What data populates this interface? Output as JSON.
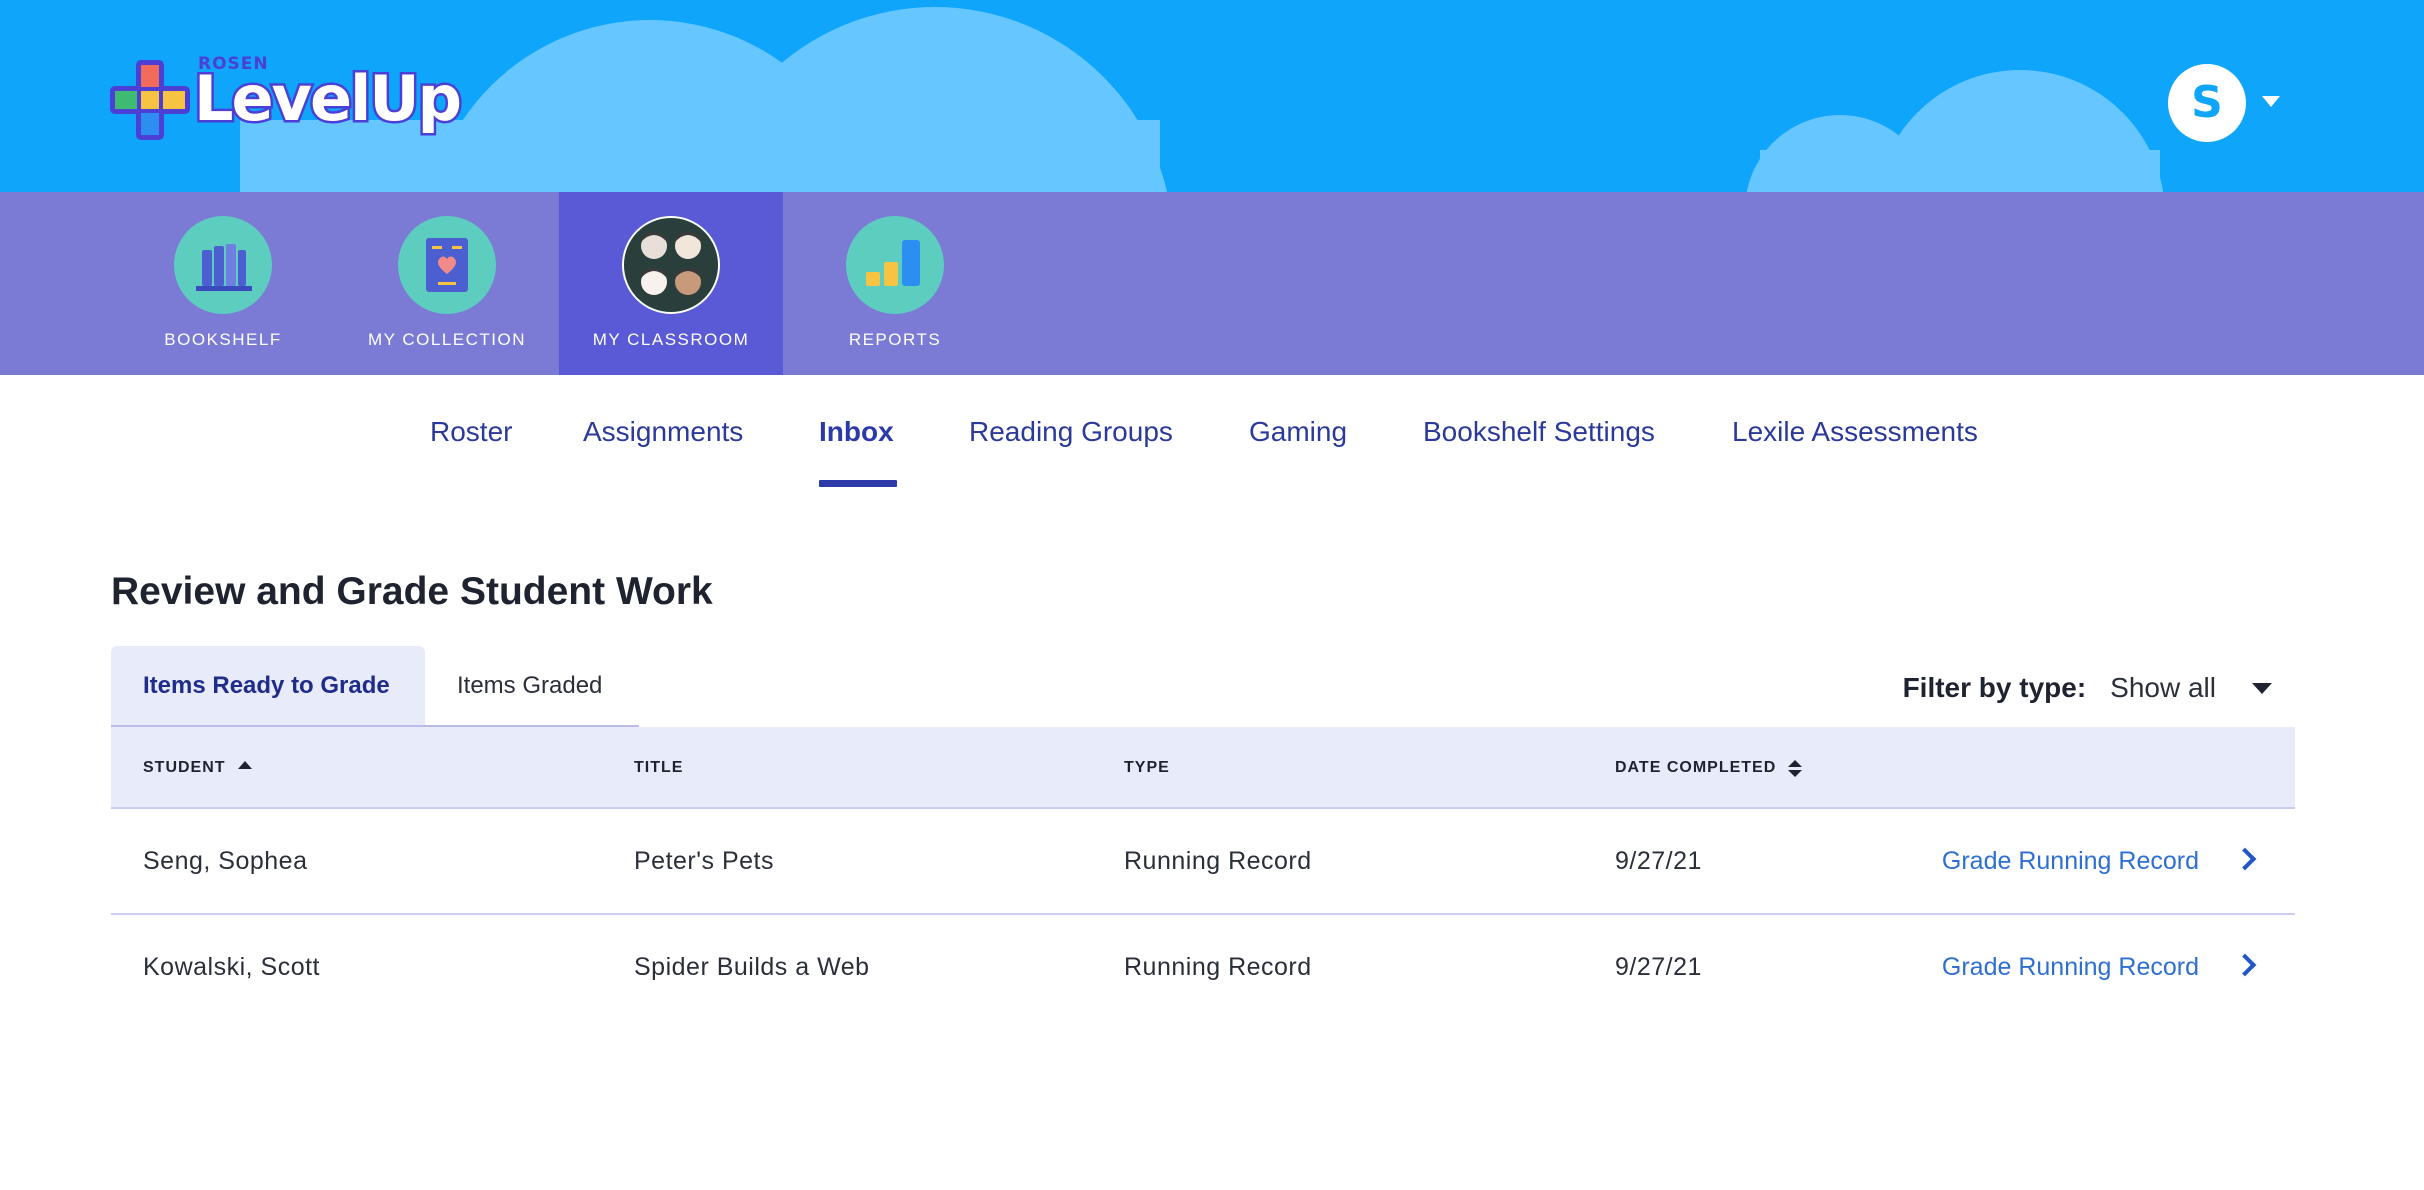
{
  "header": {
    "logo_sub": "ROSEN",
    "logo_main": "LevelUp",
    "avatar_initial": "S",
    "colors": {
      "sky": "#0ea5fa",
      "cloud": "#66c6ff",
      "logo_outline": "#4b3fd6"
    }
  },
  "main_nav": {
    "items": [
      {
        "label": "BOOKSHELF",
        "icon": "bookshelf-icon",
        "active": false
      },
      {
        "label": "MY COLLECTION",
        "icon": "book-heart-icon",
        "active": false
      },
      {
        "label": "MY CLASSROOM",
        "icon": "students-icon",
        "active": true
      },
      {
        "label": "REPORTS",
        "icon": "bar-chart-icon",
        "active": false
      }
    ],
    "colors": {
      "bar": "#7b7bd6",
      "active": "#5a59d6",
      "icon_bg": "#5ccdbf"
    }
  },
  "sub_nav": {
    "tabs": [
      "Roster",
      "Assignments",
      "Inbox",
      "Reading Groups",
      "Gaming",
      "Bookshelf Settings",
      "Lexile Assessments"
    ],
    "active": "Inbox"
  },
  "content": {
    "title": "Review and Grade Student Work",
    "tabs": {
      "ready": "Items Ready to Grade",
      "graded": "Items Graded",
      "active": "Items Ready to Grade"
    },
    "filter": {
      "label": "Filter by type:",
      "value": "Show all"
    },
    "table": {
      "columns": [
        "STUDENT",
        "TITLE",
        "TYPE",
        "DATE COMPLETED"
      ],
      "rows": [
        {
          "student": "Seng, Sophea",
          "title": "Peter's Pets",
          "type": "Running Record",
          "date": "9/27/21",
          "action": "Grade Running Record"
        },
        {
          "student": "Kowalski, Scott",
          "title": "Spider Builds a Web",
          "type": "Running Record",
          "date": "9/27/21",
          "action": "Grade Running Record"
        }
      ]
    }
  }
}
